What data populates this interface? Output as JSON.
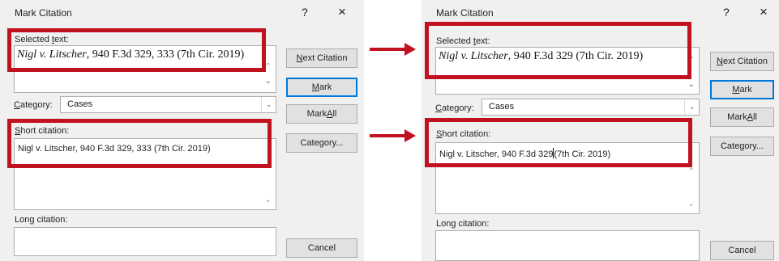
{
  "left": {
    "title": "Mark Citation",
    "help": "?",
    "close": "×",
    "selected_label_pre": "Selected ",
    "selected_label_key": "t",
    "selected_label_post": "ext:",
    "selected_italic": "Nigl v. Litscher",
    "selected_rest": ", 940 F.3d 329, 333 (7th Cir. 2019)",
    "category_label_key": "C",
    "category_label_post": "ategory:",
    "category_value": "Cases",
    "short_label_key": "S",
    "short_label_post": "hort citation:",
    "short_value": "Nigl v. Litscher, 940 F.3d 329, 333 (7th Cir. 2019)",
    "long_label": "Long citation:",
    "btn_next_key": "N",
    "btn_next_post": "ext Citation",
    "btn_mark_key": "M",
    "btn_mark_post": "ark",
    "btn_markall_pre": "Mark ",
    "btn_markall_key": "A",
    "btn_markall_post": "ll",
    "btn_category_pre": "Cate",
    "btn_category_key": "g",
    "btn_category_post": "ory...",
    "btn_cancel": "Cancel"
  },
  "right": {
    "title": "Mark Citation",
    "help": "?",
    "close": "×",
    "selected_label_pre": "Selected ",
    "selected_label_key": "t",
    "selected_label_post": "ext:",
    "selected_italic": "Nigl v. Litscher",
    "selected_rest": ", 940 F.3d 329 (7th Cir. 2019)",
    "category_label_key": "C",
    "category_label_post": "ategory:",
    "category_value": "Cases",
    "short_label_key": "S",
    "short_label_post": "hort citation:",
    "short_value_a": "Nigl v. Litscher, 940 F.3d 329",
    "short_value_b": "(7th Cir. 2019)",
    "long_label": "Long citation:",
    "btn_next_key": "N",
    "btn_next_post": "ext Citation",
    "btn_mark_key": "M",
    "btn_mark_post": "ark",
    "btn_markall_pre": "Mark ",
    "btn_markall_key": "A",
    "btn_markall_post": "ll",
    "btn_category_pre": "Cate",
    "btn_category_key": "g",
    "btn_category_post": "ory...",
    "btn_cancel": "Cancel"
  },
  "icons": {
    "up": "⌃",
    "down": "⌄",
    "combo_arrow": "⌄"
  },
  "colors": {
    "highlight": "#c1121f",
    "dialog_bg": "#f0f0f0",
    "default_button_border": "#0078d7"
  }
}
